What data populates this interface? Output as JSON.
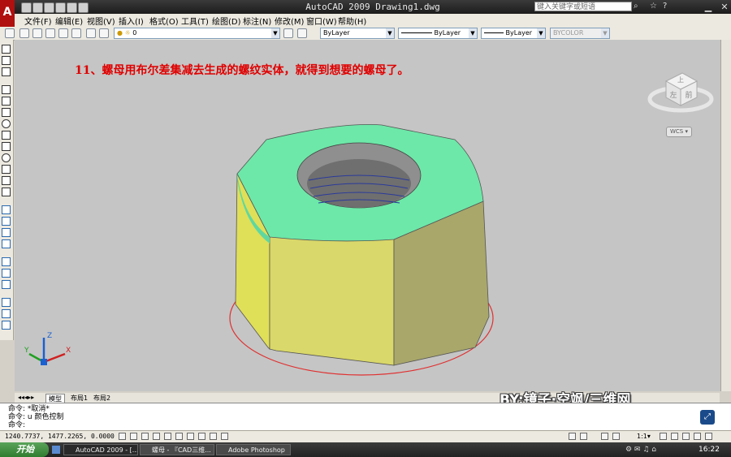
{
  "app": {
    "title": "AutoCAD 2009  Drawing1.dwg",
    "logo_letter": "A",
    "search_placeholder": "键入关键字或短语"
  },
  "menu": [
    "文件(F)",
    "编辑(E)",
    "视图(V)",
    "插入(I)",
    "格式(O)",
    "工具(T)",
    "绘图(D)",
    "标注(N)",
    "修改(M)",
    "窗口(W)",
    "帮助(H)"
  ],
  "toolbar": {
    "layer_value": "0",
    "color_value": "ByLayer",
    "linetype_value": "ByLayer",
    "lineweight_value": "ByLayer",
    "plotstyle_value": "BYCOLOR"
  },
  "viewport": {
    "caption": "11、螺母用布尔差集减去生成的螺纹实体，就得到想要的螺母了。",
    "viewcube_top": "上",
    "viewcube_left": "左",
    "viewcube_front": "前",
    "wcs_label": "WCS",
    "ucs_x": "X",
    "ucs_y": "Y",
    "ucs_z": "Z"
  },
  "tabs": [
    "模型",
    "布局1",
    "布局2"
  ],
  "command": {
    "lines": [
      "命令: *取消*",
      "命令: u 颜色控制",
      "命令:"
    ]
  },
  "status": {
    "coords": "1240.7737, 1477.2265, 0.0000",
    "scale": "1:1"
  },
  "taskbar": {
    "start": "开始",
    "tasks": [
      "AutoCAD 2009 - [...",
      "螺母 - 『CAD三维...",
      "Adobe Photoshop"
    ],
    "clock": "16:22"
  },
  "watermark": "BY:镜子·空飒/三维网",
  "colors": {
    "viewport_bg": "#c5c5c5",
    "caption": "#e00000",
    "nut_top": "#6de8a8",
    "nut_side": "#e0df58",
    "nut_side_dark": "#a9a76a"
  }
}
